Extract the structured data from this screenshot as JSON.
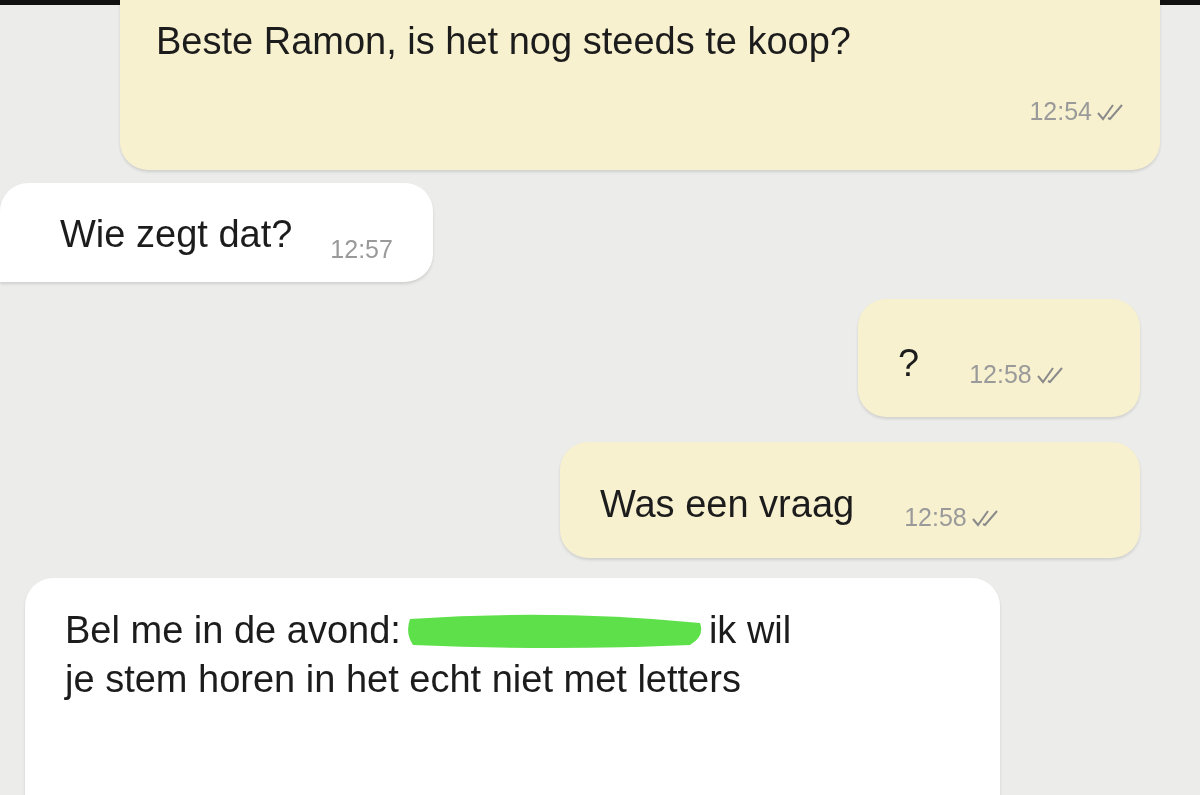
{
  "messages": [
    {
      "kind": "outgoing",
      "text": "Beste Ramon, is het nog steeds te koop?",
      "time": "12:54",
      "delivered": true
    },
    {
      "kind": "incoming",
      "text": "Wie zegt dat?",
      "time": "12:57"
    },
    {
      "kind": "outgoing",
      "text": "?",
      "time": "12:58",
      "delivered": true
    },
    {
      "kind": "outgoing",
      "text": "Was een vraag",
      "time": "12:58",
      "delivered": true
    },
    {
      "kind": "incoming",
      "lines": [
        [
          "Bel me in de avond:",
          "ik wil"
        ],
        [
          "je stem horen in het echt niet met letters"
        ]
      ],
      "redacted": true
    }
  ]
}
